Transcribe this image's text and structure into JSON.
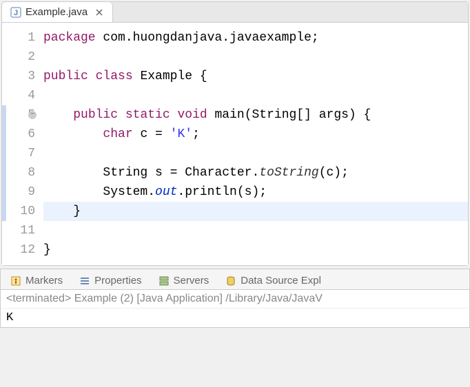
{
  "tab": {
    "label": "Example.java"
  },
  "code": {
    "lines": [
      {
        "n": 1,
        "tokens": [
          [
            "kw",
            "package"
          ],
          [
            "",
            " com.huongdanjava.javaexample;"
          ]
        ]
      },
      {
        "n": 2,
        "tokens": []
      },
      {
        "n": 3,
        "tokens": [
          [
            "kw",
            "public"
          ],
          [
            "",
            " "
          ],
          [
            "kw",
            "class"
          ],
          [
            "",
            " Example {"
          ]
        ]
      },
      {
        "n": 4,
        "tokens": []
      },
      {
        "n": 5,
        "indent": "    ",
        "fold": true,
        "changed": true,
        "tokens": [
          [
            "kw",
            "public"
          ],
          [
            "",
            " "
          ],
          [
            "kw",
            "static"
          ],
          [
            "",
            " "
          ],
          [
            "kw",
            "void"
          ],
          [
            "",
            " main(String[] args) {"
          ]
        ]
      },
      {
        "n": 6,
        "indent": "        ",
        "changed": true,
        "tokens": [
          [
            "kw",
            "char"
          ],
          [
            "",
            " c = "
          ],
          [
            "str",
            "'K'"
          ],
          [
            "",
            ";"
          ]
        ]
      },
      {
        "n": 7,
        "indent": "",
        "changed": true,
        "tokens": []
      },
      {
        "n": 8,
        "indent": "        ",
        "changed": true,
        "tokens": [
          [
            "",
            "String s = Character."
          ],
          [
            "mthd",
            "toString"
          ],
          [
            "",
            "(c);"
          ]
        ]
      },
      {
        "n": 9,
        "indent": "        ",
        "changed": true,
        "tokens": [
          [
            "",
            "System."
          ],
          [
            "field",
            "out"
          ],
          [
            "",
            ".println(s);"
          ]
        ]
      },
      {
        "n": 10,
        "indent": "    ",
        "changed": true,
        "highlight": true,
        "tokens": [
          [
            "",
            "}"
          ]
        ]
      },
      {
        "n": 11,
        "tokens": []
      },
      {
        "n": 12,
        "tokens": [
          [
            "",
            "}"
          ]
        ]
      }
    ]
  },
  "panel": {
    "tabs": [
      {
        "label": "Markers",
        "icon": "markers"
      },
      {
        "label": "Properties",
        "icon": "properties"
      },
      {
        "label": "Servers",
        "icon": "servers"
      },
      {
        "label": "Data Source Expl",
        "icon": "datasource"
      }
    ],
    "console_header": "<terminated> Example (2) [Java Application] /Library/Java/JavaV",
    "console_output": "K"
  }
}
